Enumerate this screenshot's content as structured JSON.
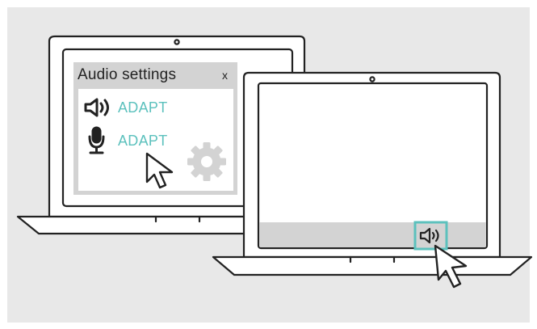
{
  "colors": {
    "background": "#e8e8e8",
    "accent": "#5cc1bd",
    "outline": "#222222",
    "panel": "#d3d3d3",
    "gear": "#ffffff"
  },
  "audio_panel": {
    "title": "Audio settings",
    "close_label": "x",
    "speaker": {
      "icon": "speaker-icon",
      "label": "ADAPT"
    },
    "microphone": {
      "icon": "microphone-icon",
      "label": "ADAPT"
    },
    "settings_icon": "gear-icon"
  },
  "taskbar": {
    "volume_icon": "speaker-icon",
    "highlighted": true
  }
}
